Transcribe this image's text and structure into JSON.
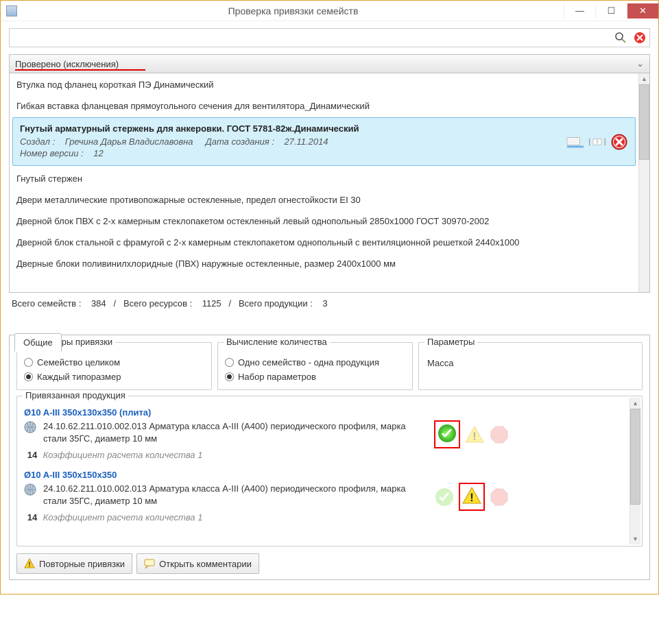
{
  "window": {
    "title": "Проверка привязки семейств"
  },
  "search": {
    "placeholder": ""
  },
  "group_header": {
    "label": "Проверено (исключения)"
  },
  "list": {
    "items": [
      {
        "label": "Втулка под фланец короткая ПЭ Динамический"
      },
      {
        "label": "Гибкая вставка фланцевая прямоугольного сечения для вентилятора_Динамический"
      }
    ],
    "selected": {
      "title": "Гнутый арматурный стержень для анкеровки. ГОСТ 5781-82ж.Динамический",
      "author_label": "Создал :",
      "author": "Гречина Дарья Владиславовна",
      "date_label": "Дата создания :",
      "date": "27.11.2014",
      "version_label": "Номер версии :",
      "version": "12"
    },
    "items_after": [
      {
        "label": "Гнутый стержен"
      },
      {
        "label": "Двери металлические противопожарные остекленные, предел огнестойкости EI 30"
      },
      {
        "label": "Дверной блок ПВХ с 2-х камерным стеклопакетом остекленный левый однопольный 2850х1000 ГОСТ 30970-2002"
      },
      {
        "label": "Дверной блок стальной с фрамугой с 2-х камерным стеклопакетом однопольный с вентиляционной решеткой 2440х1000"
      },
      {
        "label": "Дверные блоки поливинилхлоридные (ПВХ) наружные остекленные, размер 2400х1000 мм"
      }
    ]
  },
  "summary": {
    "families_label": "Всего семейств :",
    "families": "384",
    "resources_label": "Всего ресурсов :",
    "resources": "1125",
    "products_label": "Всего продукции :",
    "products": "3"
  },
  "tabs": {
    "general": "Общие"
  },
  "fieldsets": {
    "binding": {
      "legend": "Параметры привязки",
      "opt1": "Семейство целиком",
      "opt2": "Каждый типоразмер",
      "selected": "opt2"
    },
    "quantity": {
      "legend": "Вычисление количества",
      "opt1": "Одно семейство - одна продукция",
      "opt2": "Набор параметров",
      "selected": "opt2"
    },
    "params": {
      "legend": "Параметры",
      "value": "Масса"
    }
  },
  "products": {
    "legend": "Привязанная продукция",
    "items": [
      {
        "title": "Ø10 A-III 350х130х350 (плита)",
        "desc": "24.10.62.211.010.002.013 Арматура класса A-III (А400) периодического профиля, марка стали 35ГС, диаметр 10 мм",
        "coef": "14",
        "coef_label": "Коэффициент расчета количества 1",
        "status": "ok"
      },
      {
        "title": "Ø10 A-III 350х150х350",
        "desc": "24.10.62.211.010.002.013 Арматура класса A-III (А400) периодического профиля, марка стали 35ГС, диаметр 10 мм",
        "coef": "14",
        "coef_label": "Коэффициент расчета количества 1",
        "status": "warning"
      }
    ]
  },
  "footer": {
    "repeat": "Повторные привязки",
    "comments": "Открыть комментарии"
  }
}
